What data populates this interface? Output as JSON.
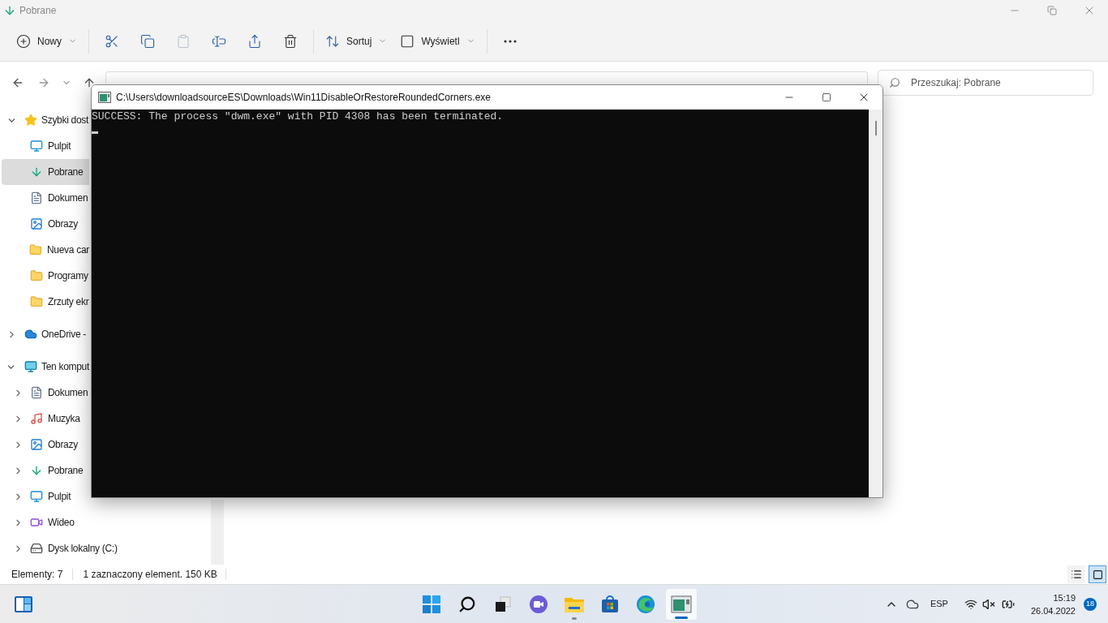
{
  "explorer": {
    "title": "Pobrane",
    "toolbar": [
      {
        "kind": "new",
        "label": "Nowy",
        "disabled": false
      },
      {
        "kind": "cut",
        "disabled": false
      },
      {
        "kind": "copy",
        "disabled": false
      },
      {
        "kind": "paste",
        "disabled": true
      },
      {
        "kind": "rename",
        "disabled": false
      },
      {
        "kind": "share",
        "disabled": false
      },
      {
        "kind": "delete",
        "disabled": false
      },
      {
        "kind": "sort",
        "label": "Sortuj",
        "disabled": false
      },
      {
        "kind": "view",
        "label": "Wyświetl",
        "disabled": false
      },
      {
        "kind": "more",
        "disabled": false
      }
    ],
    "search": {
      "placeholder": "Przeszukaj: Pobrane"
    },
    "nav": [
      {
        "label": "Szybki dost",
        "kind": "star",
        "expanded": true,
        "selected": false,
        "children": [
          {
            "label": "Pulpit",
            "kind": "desktop",
            "selected": false
          },
          {
            "label": "Pobrane",
            "kind": "download",
            "selected": true
          },
          {
            "label": "Dokumen",
            "kind": "document",
            "selected": false
          },
          {
            "label": "Obrazy",
            "kind": "pictures",
            "selected": false
          },
          {
            "label": "Nueva car",
            "kind": "folder",
            "selected": false
          },
          {
            "label": "Programy",
            "kind": "folder",
            "selected": false
          },
          {
            "label": "Zrzuty ekr",
            "kind": "folder",
            "selected": false
          }
        ]
      },
      {
        "label": "OneDrive -",
        "kind": "cloud",
        "expanded": false,
        "selected": false
      },
      {
        "label": "Ten komput",
        "kind": "computer",
        "expanded": true,
        "selected": false,
        "children": [
          {
            "label": "Dokumen",
            "kind": "document",
            "expanded": false,
            "selected": false
          },
          {
            "label": "Muzyka",
            "kind": "music",
            "expanded": false,
            "selected": false
          },
          {
            "label": "Obrazy",
            "kind": "pictures",
            "expanded": false,
            "selected": false
          },
          {
            "label": "Pobrane",
            "kind": "download",
            "expanded": false,
            "selected": false
          },
          {
            "label": "Pulpit",
            "kind": "desktop",
            "expanded": false,
            "selected": false
          },
          {
            "label": "Wideo",
            "kind": "video",
            "expanded": false,
            "selected": false
          },
          {
            "label": "Dysk lokalny (C:)",
            "kind": "drive",
            "expanded": false,
            "selected": false
          }
        ]
      }
    ],
    "status_bar": {
      "items_count": "Elementy: 7",
      "selection": "1 zaznaczony element. 150 KB"
    },
    "view_buttons": [
      {
        "kind": "details",
        "selected": false
      },
      {
        "kind": "tiles",
        "selected": true
      }
    ]
  },
  "console": {
    "title": "C:\\Users\\downloadsourceES\\Downloads\\Win11DisableOrRestoreRoundedCorners.exe",
    "lines": [
      "SUCCESS: The process \"dwm.exe\" with PID 4308 has been terminated."
    ]
  },
  "taskbar": {
    "apps": [
      {
        "kind": "start",
        "active": false
      },
      {
        "kind": "search",
        "active": false
      },
      {
        "kind": "taskview",
        "active": false
      },
      {
        "kind": "chat",
        "active": false
      },
      {
        "kind": "explorer",
        "active": false,
        "running": true
      },
      {
        "kind": "store",
        "active": false
      },
      {
        "kind": "edge",
        "active": false
      },
      {
        "kind": "console",
        "active": true,
        "running": true
      }
    ],
    "language": "ESP",
    "time": "15:19",
    "date": "26.04.2022",
    "notifications": "18"
  }
}
